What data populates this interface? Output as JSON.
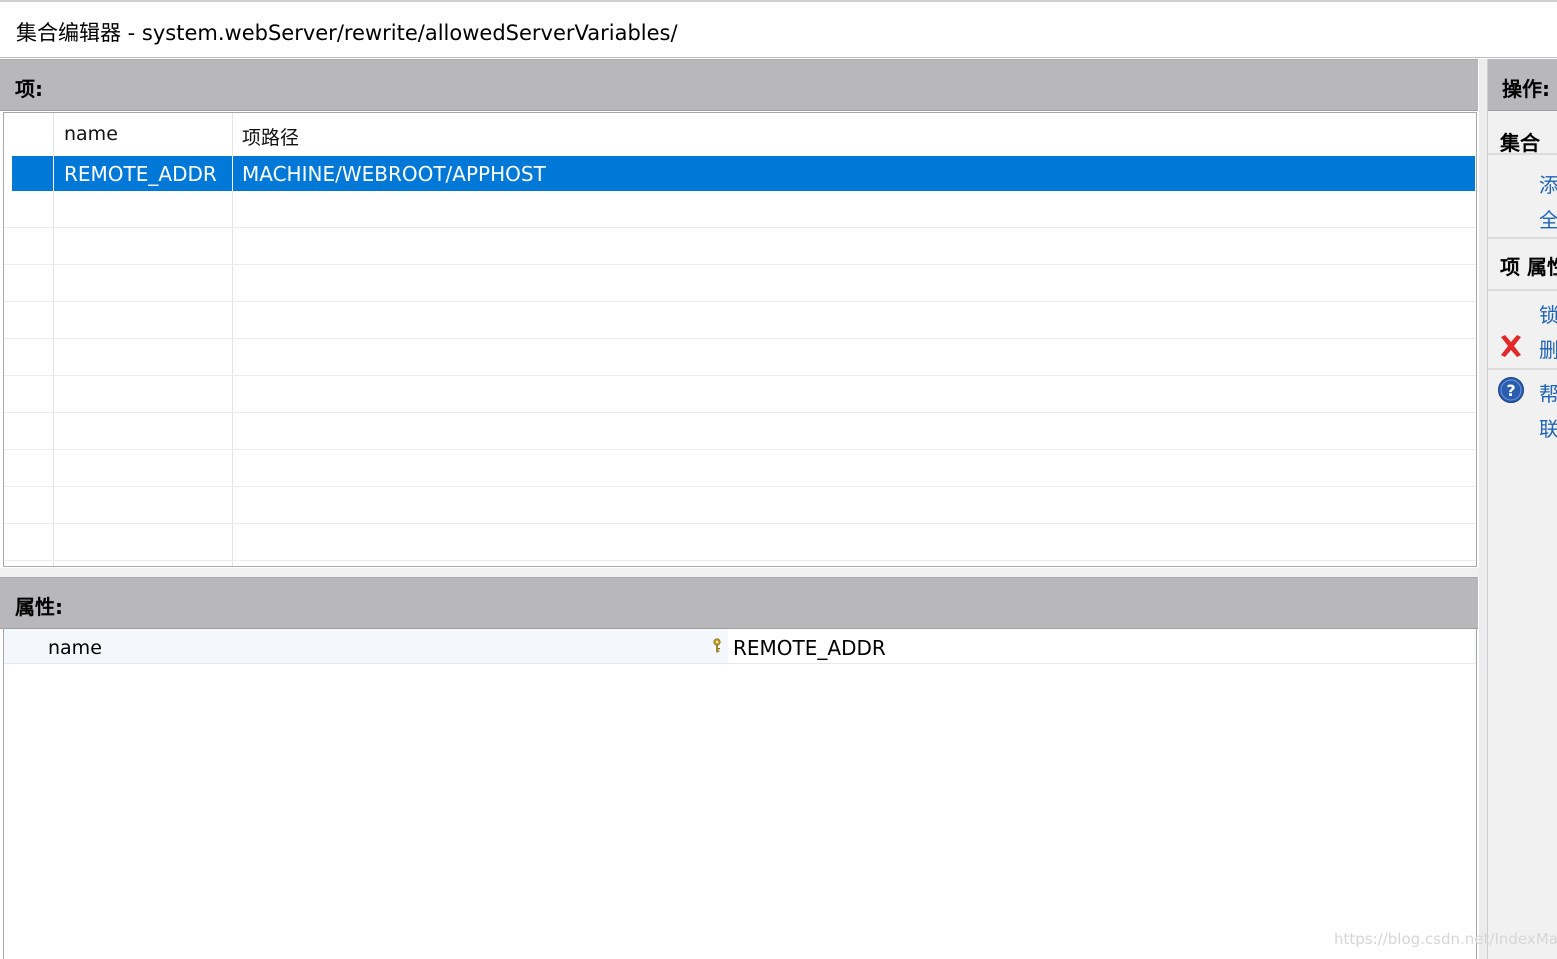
{
  "window": {
    "title": "集合编辑器 - system.webServer/rewrite/allowedServerVariables/"
  },
  "items_section": {
    "header": "项:",
    "columns": [
      "name",
      "项路径"
    ],
    "rows": [
      {
        "name": "REMOTE_ADDR",
        "path": "MACHINE/WEBROOT/APPHOST",
        "selected": true
      }
    ]
  },
  "properties_section": {
    "header": "属性:",
    "properties": [
      {
        "name": "name",
        "value": "REMOTE_ADDR",
        "icon": "key-icon"
      }
    ]
  },
  "actions_pane": {
    "header": "操作:",
    "groups": [
      {
        "title": "集合",
        "links": [
          "添",
          "全"
        ]
      },
      {
        "title": "项 属性",
        "links": [
          "锁",
          "删"
        ]
      },
      {
        "title": "",
        "links": [
          "帮",
          "联"
        ]
      }
    ],
    "icons": {
      "delete": "close-icon",
      "help": "help-icon"
    },
    "colors": {
      "link": "#1f64b5",
      "delete": "#e0292b",
      "help": "#2a5db0"
    }
  },
  "selection_color": "#0078d7",
  "watermark": "https://blog.csdn.net/IndexMan"
}
